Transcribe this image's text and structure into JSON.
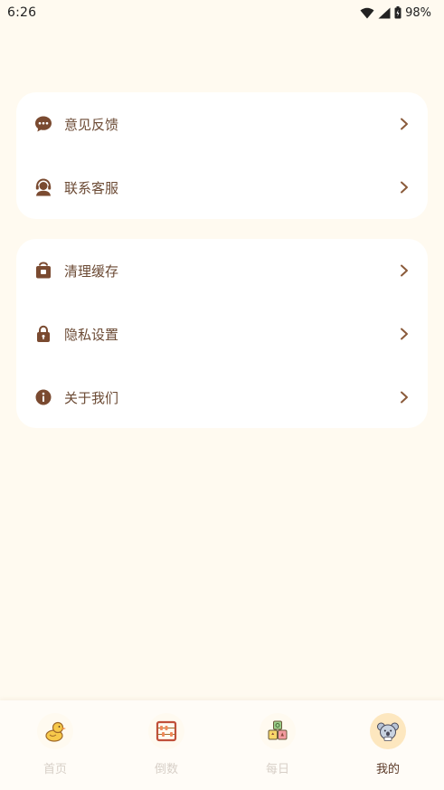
{
  "status_bar": {
    "time": "6:26",
    "battery": "98%"
  },
  "settings": {
    "group1": [
      {
        "label": "意见反馈",
        "icon": "chat-bubble-icon"
      },
      {
        "label": "联系客服",
        "icon": "customer-service-icon"
      }
    ],
    "group2": [
      {
        "label": "清理缓存",
        "icon": "storage-icon"
      },
      {
        "label": "隐私设置",
        "icon": "lock-icon"
      },
      {
        "label": "关于我们",
        "icon": "info-icon"
      }
    ]
  },
  "tabbar": {
    "items": [
      {
        "label": "首页",
        "icon": "duck-icon",
        "active": false
      },
      {
        "label": "倒数",
        "icon": "abacus-icon",
        "active": false
      },
      {
        "label": "每日",
        "icon": "blocks-icon",
        "active": false
      },
      {
        "label": "我的",
        "icon": "koala-icon",
        "active": true
      }
    ]
  },
  "colors": {
    "background": "#fffaf0",
    "card": "#ffffff",
    "text": "#6b4a34",
    "icon": "#7a4a30",
    "tab_inactive": "#d7cfc7",
    "tab_active": "#5a3826",
    "tab_active_bg": "#fde7bf"
  }
}
